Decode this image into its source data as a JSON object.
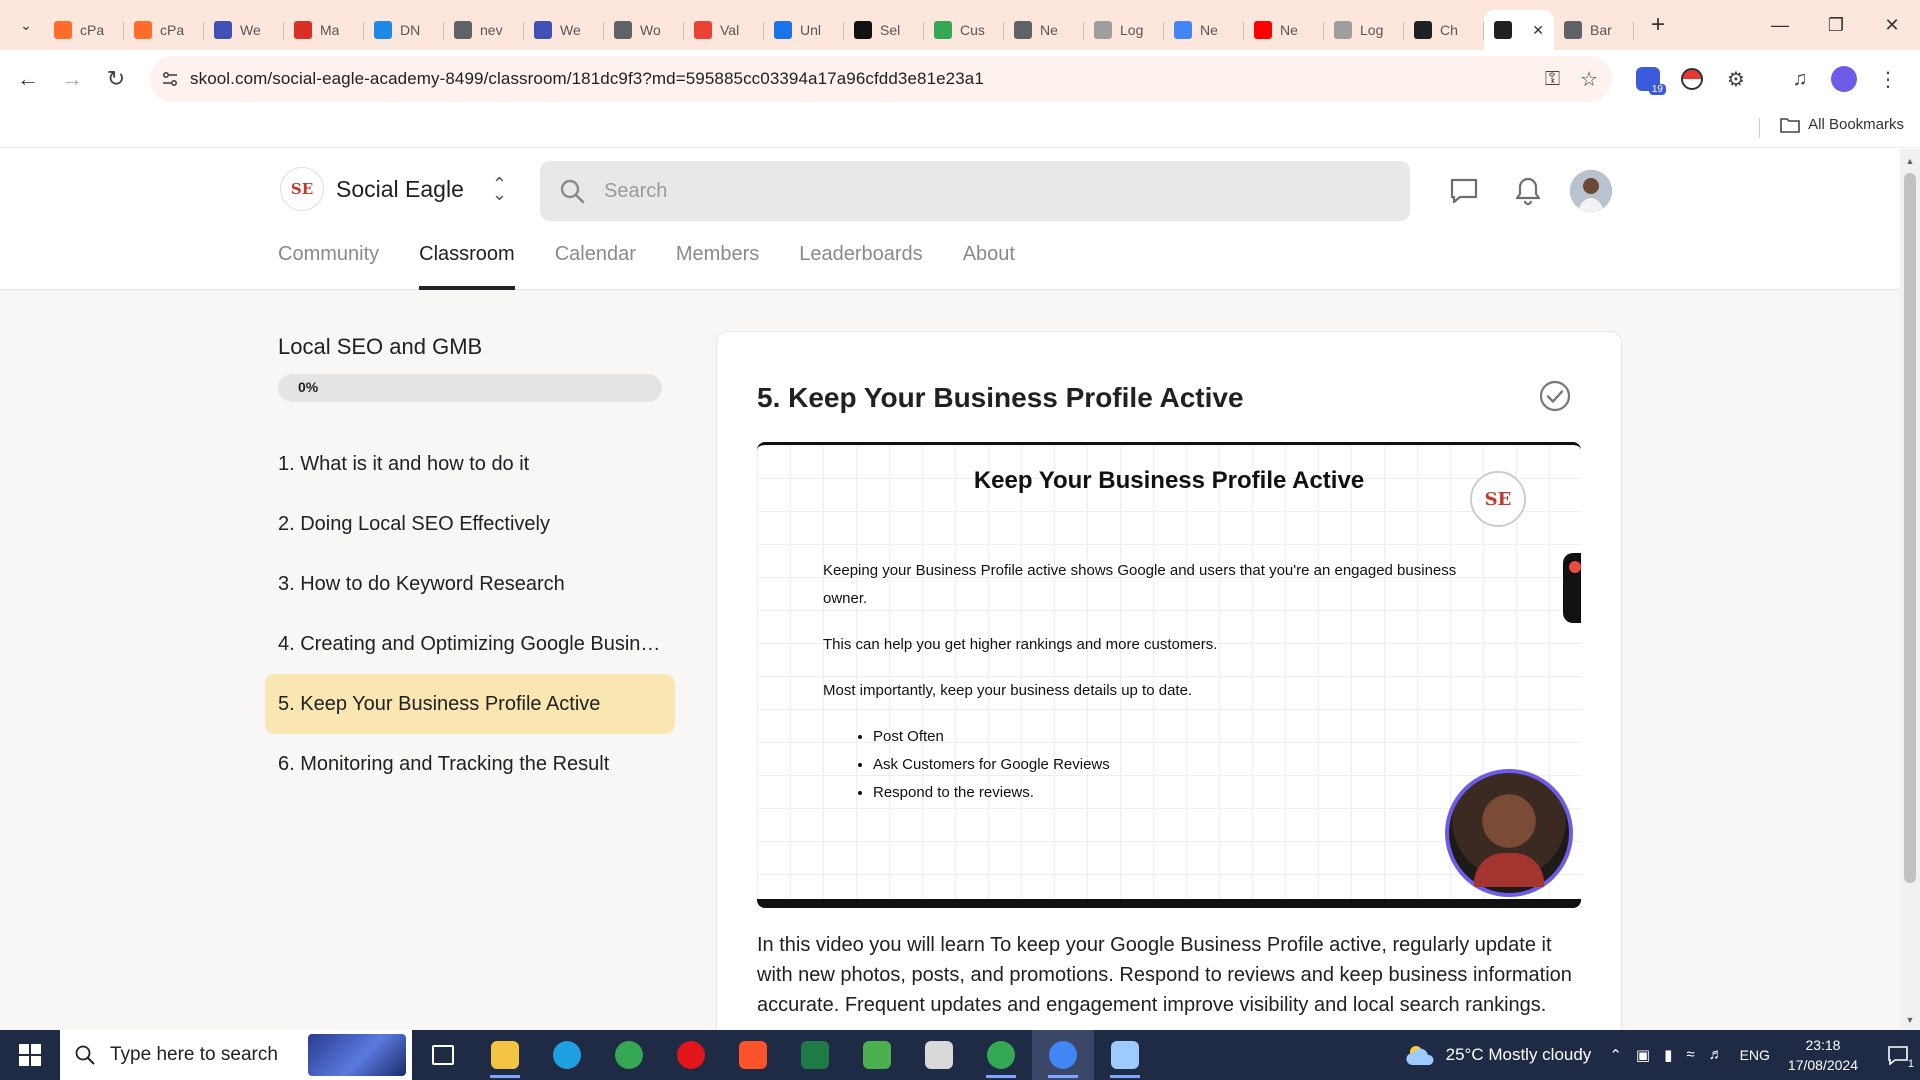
{
  "browser": {
    "tabs": [
      {
        "title": "cPa",
        "icon": "cpanel-icon",
        "color": "#ff6c2c"
      },
      {
        "title": "cPa",
        "icon": "cpanel-icon",
        "color": "#ff6c2c"
      },
      {
        "title": "We",
        "icon": "grid-apps-icon",
        "color": "#3f51b5"
      },
      {
        "title": "Ma",
        "icon": "mail-marketing-icon",
        "color": "#d93025"
      },
      {
        "title": "DN",
        "icon": "shield-location-icon",
        "color": "#1e88e5"
      },
      {
        "title": "nev",
        "icon": "globe-icon",
        "color": "#5f6368"
      },
      {
        "title": "We",
        "icon": "grid-apps-icon",
        "color": "#3f51b5"
      },
      {
        "title": "Wo",
        "icon": "globe-icon",
        "color": "#5f6368"
      },
      {
        "title": "Val",
        "icon": "gmail-icon",
        "color": "#ea4335"
      },
      {
        "title": "Unl",
        "icon": "cube-icon",
        "color": "#1a73e8"
      },
      {
        "title": "Sel",
        "icon": "m-logo-icon",
        "color": "#111111"
      },
      {
        "title": "Cus",
        "icon": "chat-bubble-icon",
        "color": "#34a853"
      },
      {
        "title": "Ne",
        "icon": "globe-icon",
        "color": "#5f6368"
      },
      {
        "title": "Log",
        "icon": "triangle-logo-icon",
        "color": "#9e9e9e"
      },
      {
        "title": "Ne",
        "icon": "google-icon",
        "color": "#4285f4"
      },
      {
        "title": "Ne",
        "icon": "youtube-icon",
        "color": "#ff0000"
      },
      {
        "title": "Log",
        "icon": "triangle-logo-icon",
        "color": "#9e9e9e"
      },
      {
        "title": "Ch",
        "icon": "chatgpt-icon",
        "color": "#202124"
      },
      {
        "title": "",
        "icon": "audio-playing-icon",
        "color": "#202124",
        "active": true
      },
      {
        "title": "Bar",
        "icon": "globe-icon",
        "color": "#5f6368"
      }
    ],
    "url": "skool.com/social-eagle-academy-8499/classroom/181dc9f3?md=595885cc03394a17a96cfdd3e81e23a1",
    "extension_badge": "19",
    "bookmarks_label": "All Bookmarks"
  },
  "site": {
    "brand_name": "Social Eagle",
    "logo_text": "SE",
    "search_placeholder": "Search",
    "nav": [
      {
        "label": "Community",
        "active": false
      },
      {
        "label": "Classroom",
        "active": true
      },
      {
        "label": "Calendar",
        "active": false
      },
      {
        "label": "Members",
        "active": false
      },
      {
        "label": "Leaderboards",
        "active": false
      },
      {
        "label": "About",
        "active": false
      }
    ]
  },
  "course": {
    "title": "Local SEO and GMB",
    "progress_label": "0%",
    "progress_fraction": 0,
    "lessons": [
      {
        "label": "1. What is it and how to do it",
        "active": false
      },
      {
        "label": "2. Doing Local SEO Effectively",
        "active": false
      },
      {
        "label": "3. How to do Keyword Research",
        "active": false
      },
      {
        "label": "4. Creating and Optimizing Google Busine...",
        "active": false
      },
      {
        "label": "5. Keep Your Business Profile Active",
        "active": true
      },
      {
        "label": "6. Monitoring and Tracking the Result",
        "active": false
      }
    ]
  },
  "lesson": {
    "heading": "5. Keep Your Business Profile Active",
    "slide": {
      "title": "Keep Your Business Profile Active",
      "logo_text": "SE",
      "paragraphs": [
        "Keeping your Business Profile active shows Google and users that you're an engaged business owner.",
        "This can help you get higher rankings and more customers.",
        "Most importantly, keep your business details up to date."
      ],
      "bullets": [
        "Post Often",
        "Ask Customers for Google Reviews",
        "Respond to the reviews."
      ]
    },
    "description": "In this video you will learn To keep your Google Business Profile active, regularly update it with new photos, posts, and promotions. Respond to reviews and keep business information accurate. Frequent updates and engagement improve visibility and local search rankings."
  },
  "taskbar": {
    "search_placeholder": "Type here to search",
    "apps": [
      {
        "icon": "task-view-icon",
        "color": "#ffffff"
      },
      {
        "icon": "file-explorer-icon",
        "color": "#f4c542"
      },
      {
        "icon": "edge-icon",
        "color": "#1fa0e0"
      },
      {
        "icon": "chrome-icon",
        "color": "#34a853"
      },
      {
        "icon": "opera-icon",
        "color": "#e3161b"
      },
      {
        "icon": "brave-icon",
        "color": "#fb542b"
      },
      {
        "icon": "spreadsheet-icon",
        "color": "#1e7b45"
      },
      {
        "icon": "photo-app-icon",
        "color": "#4caf50"
      },
      {
        "icon": "paint-icon",
        "color": "#d9d9d9"
      },
      {
        "icon": "chrome-icon",
        "color": "#34a853"
      },
      {
        "icon": "chrome-profile-icon",
        "color": "#4285f4"
      },
      {
        "icon": "paint-3d-icon",
        "color": "#9ecbff"
      }
    ],
    "weather": "25°C  Mostly cloudy",
    "language": "ENG",
    "time": "23:18",
    "date": "17/08/2024",
    "notifications": "1"
  }
}
